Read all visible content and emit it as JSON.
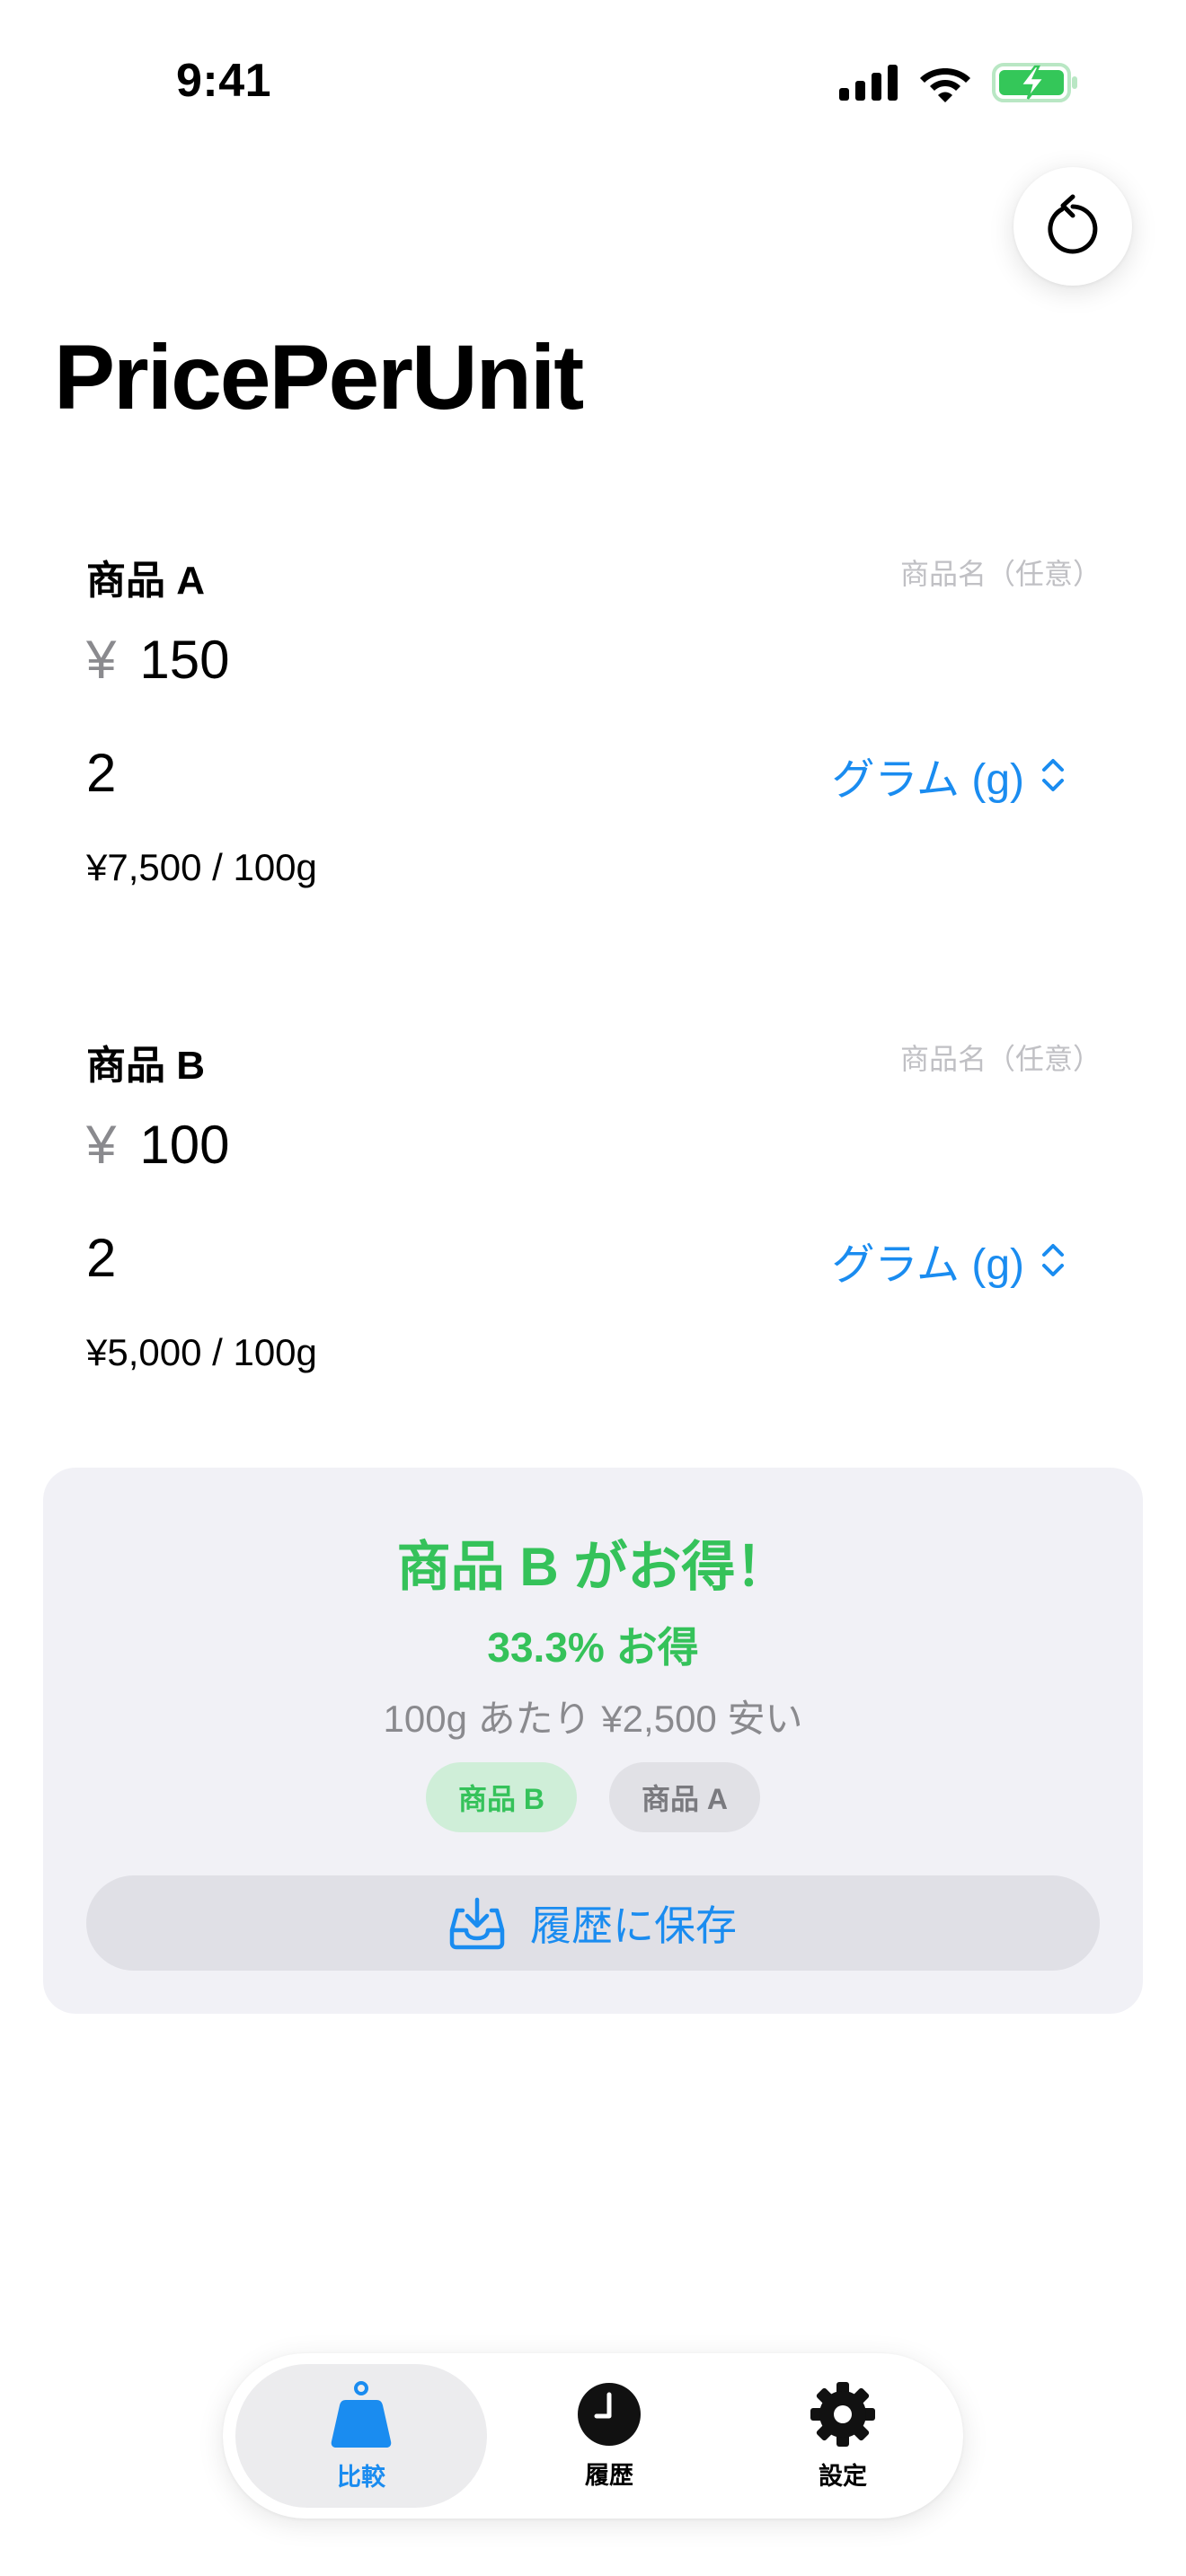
{
  "status_bar": {
    "time": "9:41"
  },
  "header": {
    "title": "PricePerUnit",
    "reset_icon": "arrow-counterclockwise-icon"
  },
  "products": [
    {
      "label": "商品 A",
      "name_placeholder": "商品名（任意）",
      "currency": "¥",
      "price": "150",
      "quantity": "2",
      "unit": "グラム (g)",
      "unit_price": "¥7,500 / 100g"
    },
    {
      "label": "商品 B",
      "name_placeholder": "商品名（任意）",
      "currency": "¥",
      "price": "100",
      "quantity": "2",
      "unit": "グラム (g)",
      "unit_price": "¥5,000 / 100g"
    }
  ],
  "result": {
    "title": "商品 B がお得！",
    "percent": "33.3% お得",
    "savings": "100g あたり ¥2,500 安い",
    "chip_winner": "商品 B",
    "chip_loser": "商品 A",
    "save_label": "履歴に保存"
  },
  "tabbar": {
    "tabs": [
      {
        "label": "比較",
        "icon": "scale-weight-icon",
        "selected": true
      },
      {
        "label": "履歴",
        "icon": "clock-icon",
        "selected": false
      },
      {
        "label": "設定",
        "icon": "gear-icon",
        "selected": false
      }
    ]
  },
  "colors": {
    "accent": "#1a8cf0",
    "success": "#35c25a",
    "battery": "#34c759"
  }
}
